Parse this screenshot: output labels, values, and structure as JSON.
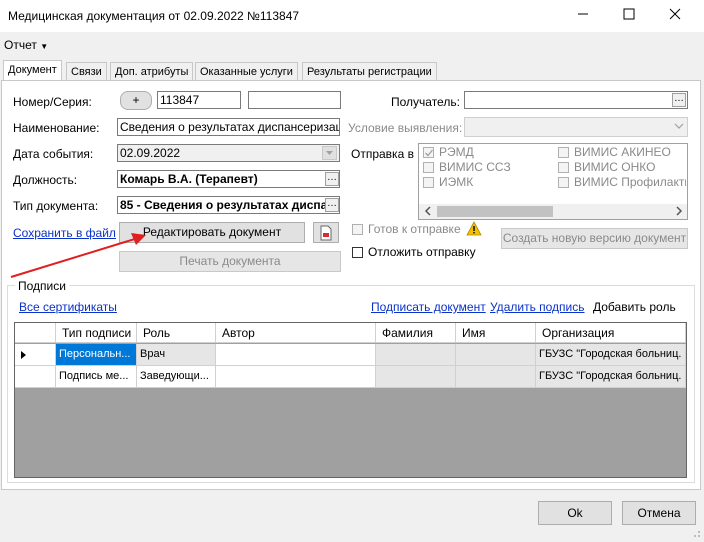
{
  "window": {
    "title": "Медицинская документация от 02.09.2022 №113847"
  },
  "menu": {
    "report": "Отчет"
  },
  "tabs": [
    "Документ",
    "Связи",
    "Доп. атрибуты",
    "Оказанные услуги",
    "Результаты регистрации"
  ],
  "form": {
    "number_label": "Номер/Серия:",
    "plus": "+",
    "number_value": "113847",
    "series_value": "",
    "name_label": "Наименование:",
    "name_value": "Сведения о результатах диспансеризации",
    "date_label": "Дата события:",
    "date_value": "02.09.2022",
    "position_label": "Должность:",
    "position_value": "Комарь В.А. (Терапевт)",
    "doctype_label": "Тип документа:",
    "doctype_value": "85 - Сведения о результатах диспа",
    "save_link": "Сохранить в файл",
    "recipient_label": "Получатель:",
    "recipient_value": "",
    "condition_label": "Условие выявления:",
    "send_label": "Отправка в",
    "send_options": [
      {
        "label": "РЭМД",
        "checked": true
      },
      {
        "label": "ВИМИС АКИНЕО",
        "checked": false
      },
      {
        "label": "ВИМИС ССЗ",
        "checked": false
      },
      {
        "label": "ВИМИС ОНКО",
        "checked": false
      },
      {
        "label": "ИЭМК",
        "checked": false
      },
      {
        "label": "ВИМИС Профилактик",
        "checked": false
      }
    ],
    "ready_label": "Готов к отправке",
    "postpone_label": "Отложить отправку",
    "create_version": "Создать новую версию документ",
    "edit_doc": "Редактировать документ",
    "print_doc": "Печать документа"
  },
  "signatures": {
    "group_label": "Подписи",
    "all_certs": "Все сертификаты",
    "sign_doc": "Подписать документ",
    "remove_sign": "Удалить подпись",
    "add_role": "Добавить роль",
    "columns": [
      "Тип подписи",
      "Роль",
      "Автор",
      "Фамилия",
      "Имя",
      "Организация"
    ],
    "rows": [
      [
        "Персональн...",
        "Врач",
        "",
        "",
        "",
        "ГБУЗС \"Городская больниц."
      ],
      [
        "Подпись ме...",
        "Заведующи...",
        "",
        "",
        "",
        "ГБУЗС \"Городская больниц."
      ]
    ]
  },
  "footer": {
    "ok": "Ok",
    "cancel": "Отмена"
  },
  "colors": {
    "link": "#0a32c8",
    "selection": "#0078d7",
    "arrow": "#e02020"
  }
}
